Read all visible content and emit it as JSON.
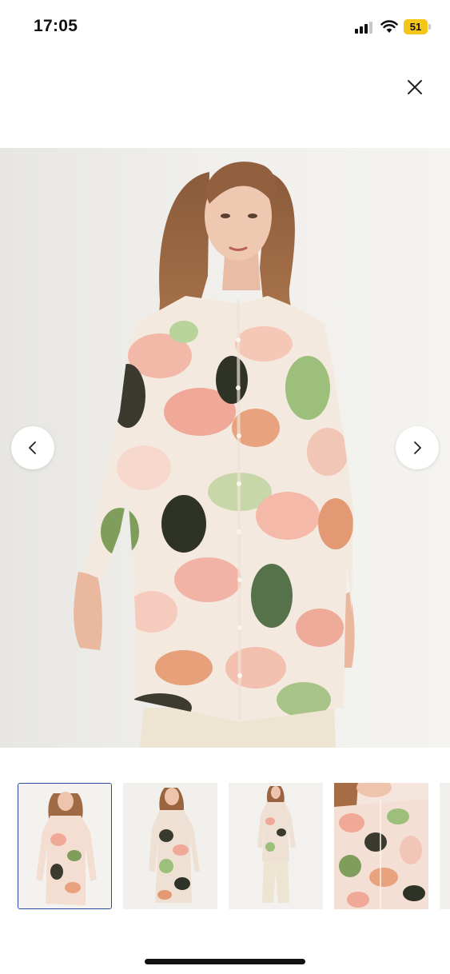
{
  "status_bar": {
    "time": "17:05",
    "battery_level": "51",
    "signal_icon": "cellular-signal-icon",
    "wifi_icon": "wifi-icon",
    "battery_icon": "battery-icon",
    "battery_color": "#f5c518"
  },
  "header": {
    "close_icon": "close-icon"
  },
  "gallery": {
    "main_image": "model-floral-tunic-photo",
    "prev_icon": "chevron-left-icon",
    "next_icon": "chevron-right-icon",
    "selected_thumbnail": 1,
    "thumbnails": [
      {
        "image": "thumbnail-front-view"
      },
      {
        "image": "thumbnail-side-view"
      },
      {
        "image": "thumbnail-full-length-view"
      },
      {
        "image": "thumbnail-detail-view"
      },
      {
        "image": "thumbnail-partial"
      }
    ],
    "accent_color": "#2a4aa8"
  }
}
